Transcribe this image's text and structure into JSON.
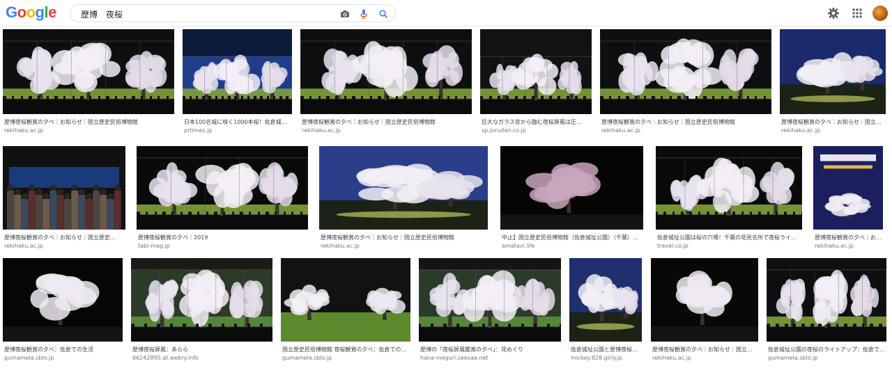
{
  "header": {
    "logo": "Google",
    "search_query": "歴博　夜桜"
  },
  "icons": {
    "camera": "camera-icon",
    "mic": "microphone-icon",
    "search": "search-icon",
    "settings": "gear-icon",
    "apps": "apps-grid-icon"
  },
  "results": [
    {
      "caption": "歴博夜桜観賞の夕べ｜お知らせ｜国立歴史民俗博物館",
      "domain": "rekihaku.ac.jp",
      "theme": "gallery",
      "sky": "#0d0f10"
    },
    {
      "caption": "日本100名城に咲く1000本桜！佐倉城…",
      "domain": "prtimes.jp",
      "theme": "panel-blue",
      "sky": "#0c1a3a"
    },
    {
      "caption": "歴博夜桜観賞の夕べ｜お知らせ｜国立歴史民俗博物館",
      "domain": "rekihaku.ac.jp",
      "theme": "gallery",
      "sky": "#0d0f10"
    },
    {
      "caption": "巨大なガラス窓から臨む夜桜屏風は圧…",
      "domain": "sp.jorudan.co.jp",
      "theme": "panel-dark",
      "sky": "#101214"
    },
    {
      "caption": "歴博夜桜観賞の夕べ｜お知らせ｜国立歴史民俗博物館",
      "domain": "rekihaku.ac.jp",
      "theme": "gallery",
      "sky": "#0d0f10"
    },
    {
      "caption": "歴博夜桜観賞の夕べ｜お知らせ｜国立歴…",
      "domain": "rekihaku.ac.jp",
      "theme": "blue-night",
      "sky": "#1b2a6b"
    },
    {
      "caption": "歴博夜桜観賞の夕べ｜お知らせ｜国立歴史…",
      "domain": "rekihaku.ac.jp",
      "theme": "crowd",
      "sky": "#111"
    },
    {
      "caption": "歴博夜桜観賞の夕べ｜2019",
      "domain": "tabi-mag.jp",
      "theme": "gallery-wide",
      "sky": "#0a0a0a"
    },
    {
      "caption": "歴博夜桜観賞の夕べ｜お知らせ｜国立歴史民俗博物館",
      "domain": "rekihaku.ac.jp",
      "theme": "blue-night",
      "sky": "#2a3e8a"
    },
    {
      "caption": "中止】国立歴史民俗博物館（佐倉城址公園）（千葉）…",
      "domain": "amatavi.life",
      "theme": "dark-pink",
      "sky": "#050505"
    },
    {
      "caption": "佐倉城址公園は桜の穴場！千葉の花見名所で夜桜ライ…",
      "domain": "travel.co.jp",
      "theme": "gallery-wide",
      "sky": "#0a0a0a"
    },
    {
      "caption": "歴博夜桜観賞の夕べ｜お…",
      "domain": "rekihaku.ac.jp",
      "theme": "poster",
      "sky": "#1a1f5c"
    },
    {
      "caption": "歴博夜桜観賞の夕べ：佐倉での生活",
      "domain": "gumamela.sblo.jp",
      "theme": "dark-white",
      "sky": "#060606"
    },
    {
      "caption": "歴博夜桜屏風：あらら",
      "domain": "66242895.at.webry.info",
      "theme": "green-glass",
      "sky": "#1a1a16"
    },
    {
      "caption": "国立歴史民俗博物館 夜桜観賞の夕べ：佐倉での…",
      "domain": "gumamela.sblo.jp",
      "theme": "lawn",
      "sky": "#121212"
    },
    {
      "caption": "歴博の「夜桜屏風鑑賞の夕べ」：花めぐり",
      "domain": "hana-meguri.seesaa.net",
      "theme": "green-glass",
      "sky": "#151515"
    },
    {
      "caption": "佐倉城址公園と歴博夜桜…",
      "domain": "mickey.828.girly.jp",
      "theme": "blue-night",
      "sky": "#20306e"
    },
    {
      "caption": "歴博夜桜観賞の夕べ｜お知らせ｜国立…",
      "domain": "rekihaku.ac.jp",
      "theme": "dark-white",
      "sky": "#080808"
    },
    {
      "caption": "佐倉城址公園の夜桜のライトアップ：佐倉で…",
      "domain": "gumamela.sblo.jp",
      "theme": "gallery",
      "sky": "#0d0f10"
    }
  ]
}
